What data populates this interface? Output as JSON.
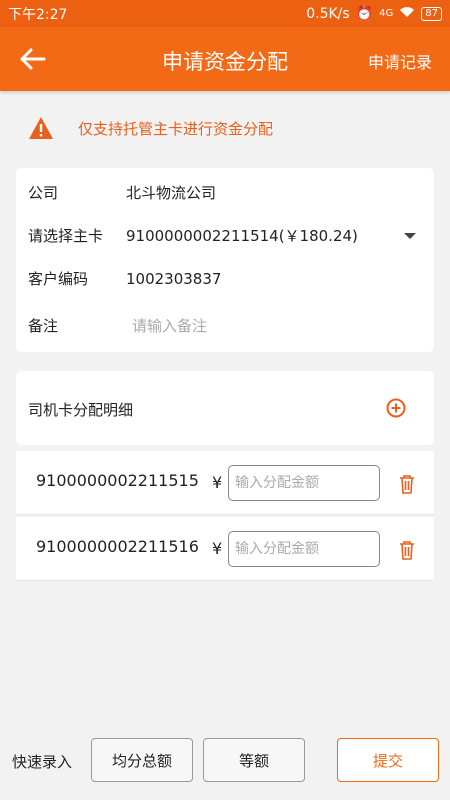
{
  "status_bar": {
    "time": "下午2:27",
    "speed": "0.5K/s",
    "network": "4G",
    "battery": "87"
  },
  "app_bar": {
    "title": "申请资金分配",
    "records_label": "申请记录"
  },
  "notice": {
    "text": "仅支持托管主卡进行资金分配"
  },
  "form": {
    "company_label": "公司",
    "company_value": "北斗物流公司",
    "main_card_label": "请选择主卡",
    "main_card_value": "9100000002211514(￥180.24)",
    "customer_code_label": "客户编码",
    "customer_code_value": "1002303837",
    "remark_label": "备注",
    "remark_placeholder": "请输入备注"
  },
  "driver_section": {
    "title": "司机卡分配明细",
    "rows": [
      {
        "card_number": "9100000002211515",
        "currency": "¥",
        "amount_placeholder": "输入分配金额"
      },
      {
        "card_number": "9100000002211516",
        "currency": "¥",
        "amount_placeholder": "输入分配金额"
      }
    ]
  },
  "bottom_bar": {
    "quick_label": "快速录入",
    "split_total_label": "均分总额",
    "equal_label": "等额",
    "submit_label": "提交"
  },
  "colors": {
    "primary": "#f26a16",
    "warning": "#e8601c"
  }
}
